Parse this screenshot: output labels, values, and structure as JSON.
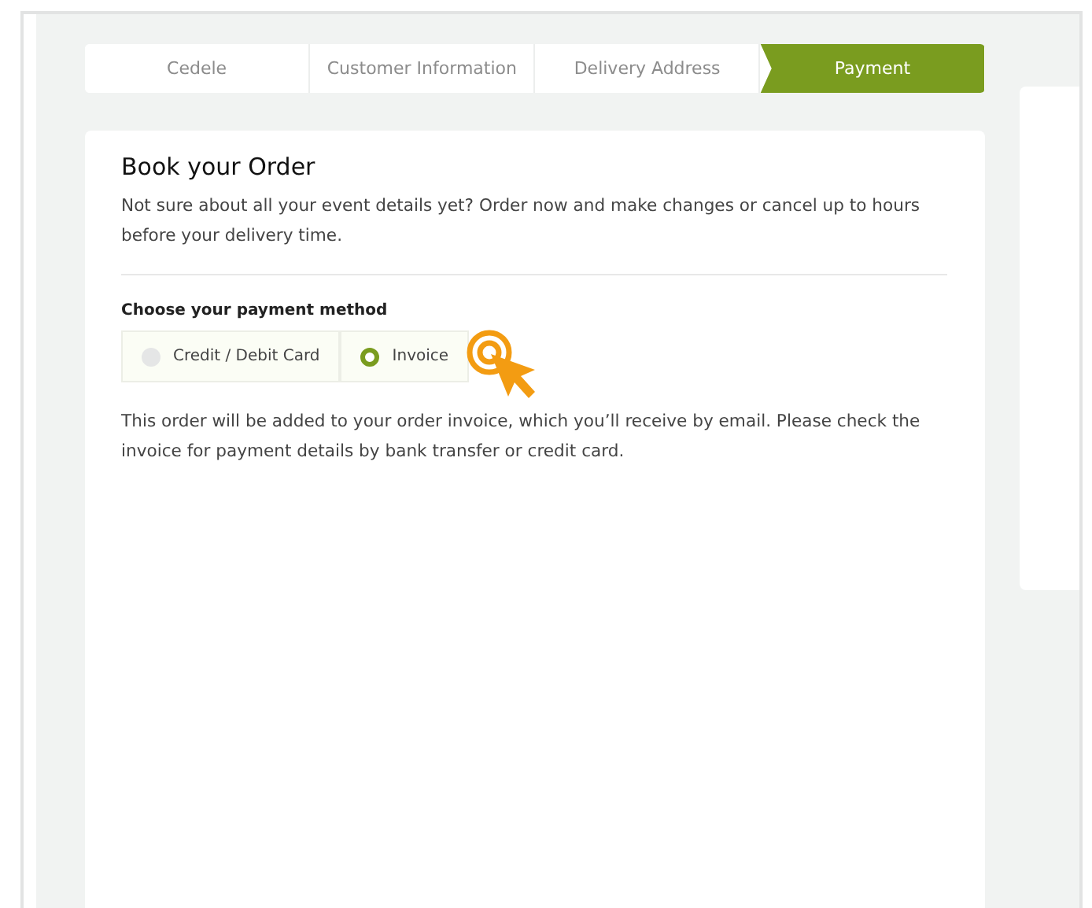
{
  "steps": [
    {
      "label": "Cedele",
      "selected": false
    },
    {
      "label": "Customer Information",
      "selected": false
    },
    {
      "label": "Delivery Address",
      "selected": false
    },
    {
      "label": "Payment",
      "selected": true
    }
  ],
  "card": {
    "title": "Book your Order",
    "intro": "Not sure about all your event details yet? Order now and make changes or cancel up to hours before your delivery time.",
    "payment_heading": "Choose your payment method",
    "payment_options": [
      {
        "label": "Credit / Debit Card",
        "selected": false
      },
      {
        "label": "Invoice",
        "selected": true
      }
    ],
    "note": "This order will be added to your order invoice, which you’ll receive by email. Please check the invoice for payment details by bank transfer or credit card."
  }
}
